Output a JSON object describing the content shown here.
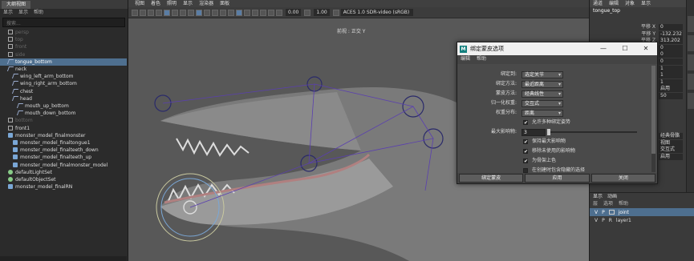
{
  "outliner": {
    "title": "大纲视图",
    "menu": [
      "显示",
      "显示",
      "帮助"
    ],
    "search_placeholder": "搜索...",
    "items": [
      {
        "label": "persp",
        "dim": true
      },
      {
        "label": "top",
        "dim": true
      },
      {
        "label": "front",
        "dim": true
      },
      {
        "label": "side",
        "dim": true
      },
      {
        "label": "tongue_bottom",
        "selected": true
      },
      {
        "label": "neck"
      },
      {
        "label": "wing_left_arm_bottom"
      },
      {
        "label": "wing_right_arm_bottom"
      },
      {
        "label": "chest"
      },
      {
        "label": "head"
      },
      {
        "label": "mouth_up_bottom"
      },
      {
        "label": "mouth_down_bottom"
      },
      {
        "label": "bottom",
        "dim": true
      },
      {
        "label": "front1"
      },
      {
        "label": "monster_model_finalmonster"
      },
      {
        "label": "monster_model_finaltongue1"
      },
      {
        "label": "monster_model_finalteeth_down"
      },
      {
        "label": "monster_model_finalteeth_up"
      },
      {
        "label": "monster_model_finalmonster_model"
      },
      {
        "label": "defaultLightSet"
      },
      {
        "label": "defaultObjectSet"
      },
      {
        "label": "monster_model_finalRN"
      }
    ]
  },
  "viewport": {
    "menu": [
      "视图",
      "着色",
      "照明",
      "显示",
      "渲染器",
      "面板"
    ],
    "field_left": "0.00",
    "field_right": "1.00",
    "colorspace": "ACES 1.0 SDR-video (sRGB)",
    "camera_label": "前视 : 正交 Y"
  },
  "channel_box": {
    "menu": [
      "通道",
      "编辑",
      "对象",
      "显示"
    ],
    "object": "tongue_top",
    "attributes": [
      {
        "name": "平移 X",
        "value": "0"
      },
      {
        "name": "平移 Y",
        "value": "-132.232"
      },
      {
        "name": "平移 Z",
        "value": "313.202"
      },
      {
        "name": "旋转 X",
        "value": "0"
      },
      {
        "name": "旋转 Y",
        "value": "0"
      },
      {
        "name": "旋转 Z",
        "value": "0"
      },
      {
        "name": "缩放 X",
        "value": "1"
      },
      {
        "name": "缩放 Y",
        "value": "1"
      },
      {
        "name": "缩放 Z",
        "value": "1"
      },
      {
        "name": "可见性",
        "value": "启用"
      },
      {
        "name": "半径",
        "value": "50"
      }
    ],
    "lower_values": [
      "经典骨骼",
      "视图",
      "交互式",
      "启用"
    ]
  },
  "layers": {
    "tabs": [
      "显示",
      "动画"
    ],
    "menu": [
      "层",
      "选项",
      "帮助"
    ],
    "rows": [
      {
        "v": "V",
        "p": "P",
        "name": "joint",
        "selected": true
      },
      {
        "v": "V",
        "p": "P",
        "r": "R",
        "name": "layer1"
      }
    ]
  },
  "dialog": {
    "title": "绑定蒙皮选项",
    "menu": [
      "编辑",
      "帮助"
    ],
    "options": [
      {
        "label": "绑定到:",
        "value": "选定关节"
      },
      {
        "label": "绑定方法:",
        "value": "最近距离"
      },
      {
        "label": "蒙皮方法:",
        "value": "经典线性"
      },
      {
        "label": "归一化权重:",
        "value": "交互式"
      },
      {
        "label": "权重分布:",
        "value": "距离"
      }
    ],
    "allow_multiple_bind": "允许多种绑定姿势",
    "max_influences_label": "最大影响物:",
    "max_influences": "3",
    "checks": [
      {
        "label": "保持最大影响物",
        "checked": true
      },
      {
        "label": "移除未使用的影响物",
        "checked": true
      },
      {
        "label": "为骨架上色",
        "checked": true
      },
      {
        "label": "在创建时包含隐藏的选择",
        "checked": false
      }
    ],
    "buttons": [
      "绑定蒙皮",
      "应用",
      "关闭"
    ]
  }
}
